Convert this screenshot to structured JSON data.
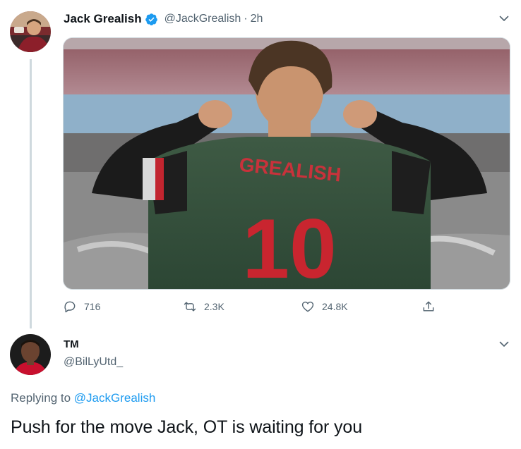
{
  "tweet1": {
    "author_name": "Jack Grealish",
    "handle": "@JackGrealish",
    "separator": "·",
    "time": "2h",
    "verified": true,
    "image": {
      "jersey_name": "GREALISH",
      "jersey_number": "10"
    },
    "actions": {
      "replies": "716",
      "retweets": "2.3K",
      "likes": "24.8K"
    }
  },
  "tweet2": {
    "author_name": "TM",
    "handle": "@BilLyUtd_",
    "replying_prefix": "Replying to",
    "replying_to": "@JackGrealish",
    "text": "Push for the move Jack, OT is waiting for you"
  },
  "icons": {
    "reply": "comment-icon",
    "retweet": "retweet-icon",
    "like": "heart-icon",
    "share": "share-icon",
    "more": "chevron-down-icon",
    "verified": "verified-badge-icon"
  },
  "colors": {
    "link": "#1d9bf0",
    "secondary_text": "#536471",
    "verified": "#1d9bf0",
    "thread_line": "#cfd9de"
  }
}
